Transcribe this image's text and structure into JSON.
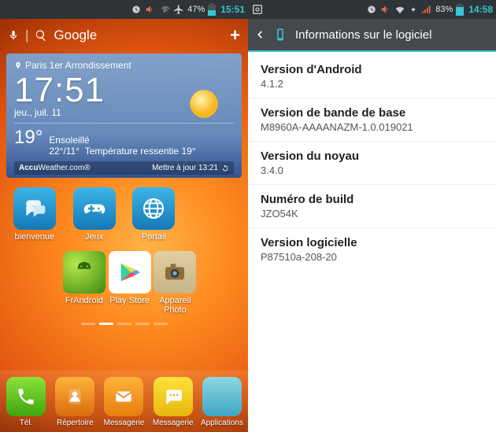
{
  "left": {
    "status": {
      "battery_pct": "47%",
      "clock": "15:51"
    },
    "search": {
      "label": "Google"
    },
    "weather": {
      "location": "Paris 1er Arrondissement",
      "time": "17:51",
      "date": "jeu., juil. 11",
      "temp": "19°",
      "condition": "Ensoleillé",
      "hilo": "22°/11°",
      "feels": "Température ressentie 19°",
      "brand_prefix": "Accu",
      "brand_rest": "Weather.com",
      "update_label": "Mettre à jour 13:21"
    },
    "apps_row1": [
      {
        "label": "bienvenue"
      },
      {
        "label": "Jeux"
      },
      {
        "label": "Portail"
      }
    ],
    "apps_row2": [
      {
        "label": "FrAndroid"
      },
      {
        "label": "Play Store"
      },
      {
        "label": "Appareil Photo"
      }
    ],
    "dock": [
      {
        "label": "Tél."
      },
      {
        "label": "Répertoire"
      },
      {
        "label": "Messagerie"
      },
      {
        "label": "Messagerie"
      },
      {
        "label": "Applications"
      }
    ]
  },
  "right": {
    "status": {
      "battery_pct": "83%",
      "clock": "14:58"
    },
    "header": {
      "title": "Informations sur le logiciel"
    },
    "items": [
      {
        "k": "Version d'Android",
        "v": "4.1.2"
      },
      {
        "k": "Version de bande de base",
        "v": "M8960A-AAAANAZM-1.0.019021"
      },
      {
        "k": "Version du noyau",
        "v": "3.4.0"
      },
      {
        "k": "Numéro de build",
        "v": "JZO54K"
      },
      {
        "k": "Version logicielle",
        "v": "P87510a-208-20"
      }
    ]
  }
}
